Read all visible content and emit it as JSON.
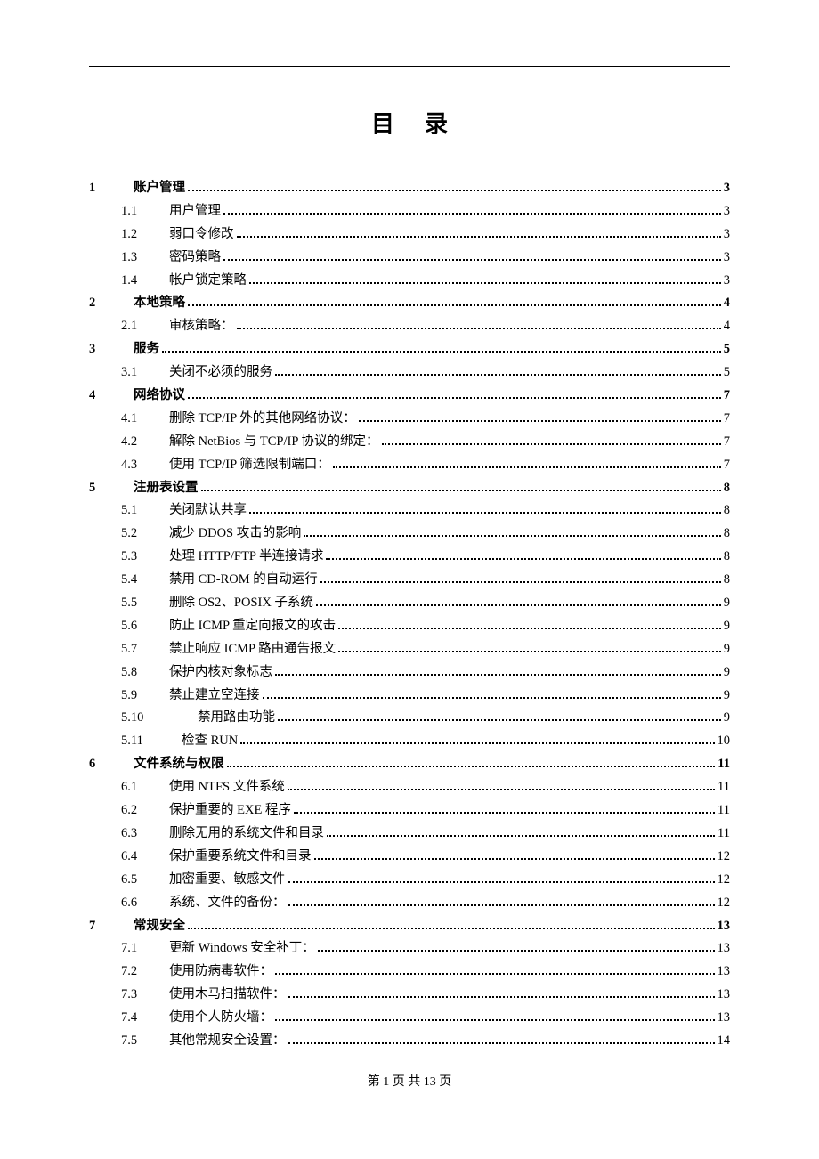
{
  "title": "目录",
  "footer": {
    "prefix": "第 ",
    "cur": "1",
    "mid": " 页 共 ",
    "total": "13",
    "suffix": " 页"
  },
  "toc": [
    {
      "level": 1,
      "num": "1",
      "label": "账户管理",
      "page": "3"
    },
    {
      "level": 2,
      "num": "1.1",
      "label": "用户管理",
      "page": "3"
    },
    {
      "level": 2,
      "num": "1.2",
      "label": "弱口令修改",
      "page": "3"
    },
    {
      "level": 2,
      "num": "1.3",
      "label": "密码策略",
      "page": "3"
    },
    {
      "level": 2,
      "num": "1.4",
      "label": "帐户锁定策略",
      "page": "3"
    },
    {
      "level": 1,
      "num": "2",
      "label": "本地策略",
      "page": "4"
    },
    {
      "level": 2,
      "num": "2.1",
      "label": "审核策略：",
      "page": "4"
    },
    {
      "level": 1,
      "num": "3",
      "label": "服务",
      "page": "5"
    },
    {
      "level": 2,
      "num": "3.1",
      "label": "关闭不必须的服务",
      "page": "5"
    },
    {
      "level": 1,
      "num": "4",
      "label": "网络协议",
      "page": "7"
    },
    {
      "level": 2,
      "num": "4.1",
      "label": "删除 TCP/IP 外的其他网络协议：",
      "page": "7"
    },
    {
      "level": 2,
      "num": "4.2",
      "label": "解除 NetBios 与 TCP/IP 协议的绑定：",
      "page": "7"
    },
    {
      "level": 2,
      "num": "4.3",
      "label": "使用 TCP/IP 筛选限制端口：",
      "page": "7"
    },
    {
      "level": 1,
      "num": "5",
      "label": "注册表设置",
      "page": "8"
    },
    {
      "level": 2,
      "num": "5.1",
      "label": "关闭默认共享",
      "page": "8"
    },
    {
      "level": 2,
      "num": "5.2",
      "label": "减少 DDOS 攻击的影响",
      "page": "8"
    },
    {
      "level": 2,
      "num": "5.3",
      "label": "处理 HTTP/FTP 半连接请求",
      "page": "8"
    },
    {
      "level": 2,
      "num": "5.4",
      "label": "禁用 CD-ROM 的自动运行",
      "page": "8"
    },
    {
      "level": 2,
      "num": "5.5",
      "label": "删除 OS2、POSIX 子系统",
      "page": "9"
    },
    {
      "level": 2,
      "num": "5.6",
      "label": "防止 ICMP 重定向报文的攻击",
      "page": "9"
    },
    {
      "level": 2,
      "num": "5.7",
      "label": "禁止响应 ICMP 路由通告报文",
      "page": "9"
    },
    {
      "level": 2,
      "num": "5.8",
      "label": "保护内核对象标志",
      "page": "9"
    },
    {
      "level": 2,
      "num": "5.9",
      "label": "禁止建立空连接",
      "page": "9"
    },
    {
      "level": 2,
      "num": "5.10",
      "label": "禁用路由功能",
      "page": "9",
      "extra_indent": true
    },
    {
      "level": 2,
      "num": "5.11",
      "label": "检查 RUN",
      "page": "10"
    },
    {
      "level": 1,
      "num": "6",
      "label": "文件系统与权限",
      "page": "11"
    },
    {
      "level": 2,
      "num": "6.1",
      "label": "使用 NTFS 文件系统",
      "page": "11"
    },
    {
      "level": 2,
      "num": "6.2",
      "label": "保护重要的 EXE 程序",
      "page": "11"
    },
    {
      "level": 2,
      "num": "6.3",
      "label": "删除无用的系统文件和目录",
      "page": "11"
    },
    {
      "level": 2,
      "num": "6.4",
      "label": "保护重要系统文件和目录",
      "page": "12"
    },
    {
      "level": 2,
      "num": "6.5",
      "label": "加密重要、敏感文件",
      "page": "12"
    },
    {
      "level": 2,
      "num": "6.6",
      "label": "系统、文件的备份：",
      "page": "12"
    },
    {
      "level": 1,
      "num": "7",
      "label": "常规安全",
      "page": "13"
    },
    {
      "level": 2,
      "num": "7.1",
      "label": "更新 Windows 安全补丁：",
      "page": "13"
    },
    {
      "level": 2,
      "num": "7.2",
      "label": "使用防病毒软件：",
      "page": "13"
    },
    {
      "level": 2,
      "num": "7.3",
      "label": "使用木马扫描软件：",
      "page": "13"
    },
    {
      "level": 2,
      "num": "7.4",
      "label": "使用个人防火墙：",
      "page": "13"
    },
    {
      "level": 2,
      "num": "7.5",
      "label": "其他常规安全设置：",
      "page": "14"
    }
  ]
}
